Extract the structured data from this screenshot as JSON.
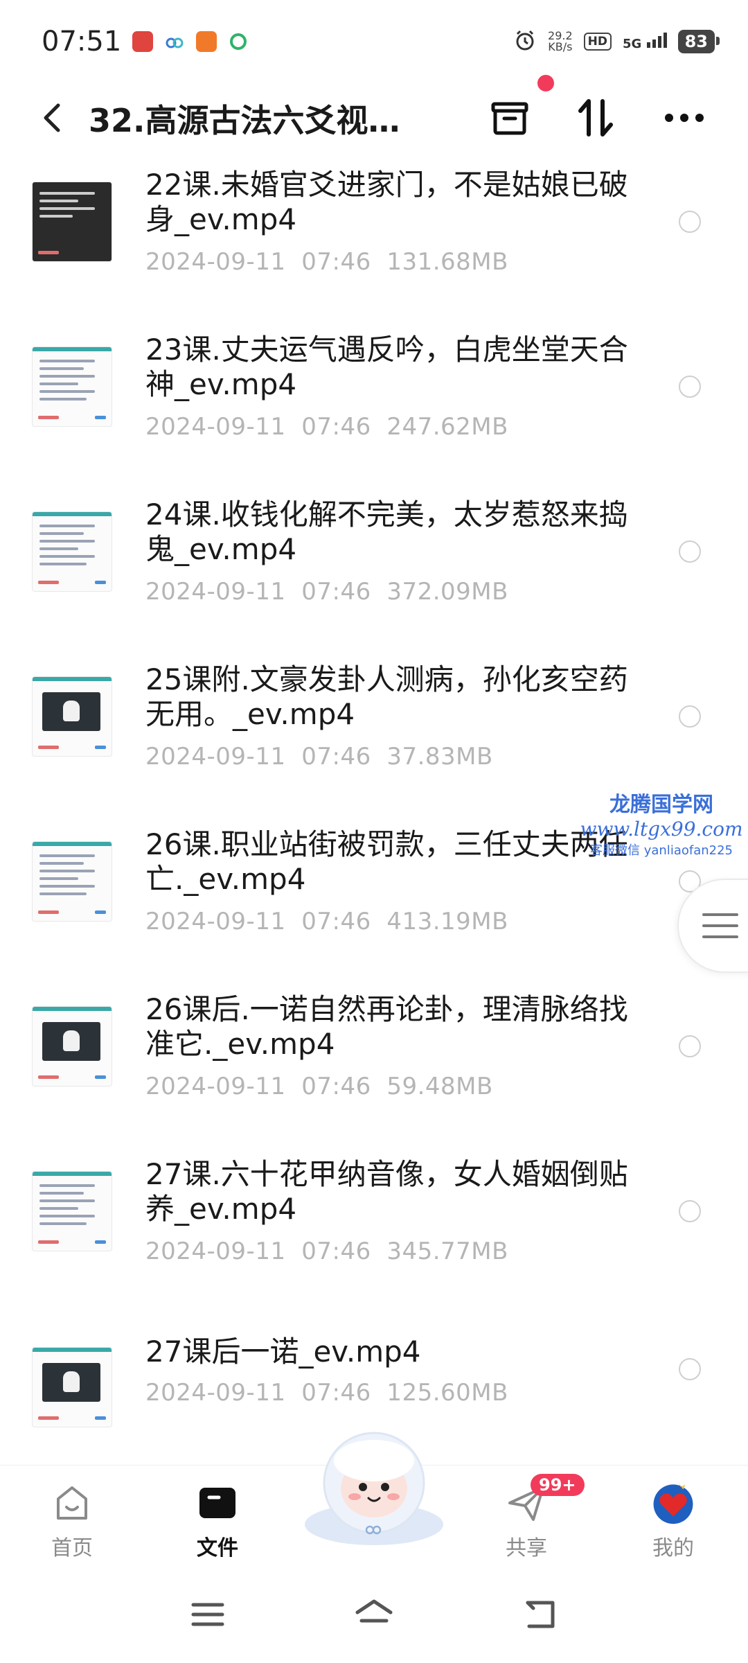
{
  "status_bar": {
    "time": "07:51",
    "speed_value": "29.2",
    "speed_unit": "KB/s",
    "hd": "HD",
    "network": "5G",
    "battery": "83"
  },
  "header": {
    "title": "32.高源古法六爻视…"
  },
  "files": [
    {
      "name": "22课.未婚官爻进家门，不是姑娘已破身_ev.mp4",
      "date": "2024-09-11",
      "time": "07:46",
      "size": "131.68MB",
      "thumb": "dark"
    },
    {
      "name": "23课.丈夫运气遇反吟，白虎坐堂天合神_ev.mp4",
      "date": "2024-09-11",
      "time": "07:46",
      "size": "247.62MB",
      "thumb": "doc"
    },
    {
      "name": "24课.收钱化解不完美，太岁惹怒来捣鬼_ev.mp4",
      "date": "2024-09-11",
      "time": "07:46",
      "size": "372.09MB",
      "thumb": "doc"
    },
    {
      "name": "25课附.文豪发卦人测病，孙化亥空药无用。_ev.mp4",
      "date": "2024-09-11",
      "time": "07:46",
      "size": "37.83MB",
      "thumb": "screen"
    },
    {
      "name": "26课.职业站街被罚款，三任丈夫两任亡._ev.mp4",
      "date": "2024-09-11",
      "time": "07:46",
      "size": "413.19MB",
      "thumb": "doc"
    },
    {
      "name": "26课后.一诺自然再论卦，理清脉络找准它._ev.mp4",
      "date": "2024-09-11",
      "time": "07:46",
      "size": "59.48MB",
      "thumb": "screen"
    },
    {
      "name": "27课.六十花甲纳音像，女人婚姻倒贴养_ev.mp4",
      "date": "2024-09-11",
      "time": "07:46",
      "size": "345.77MB",
      "thumb": "doc"
    },
    {
      "name": "27课后一诺_ev.mp4",
      "date": "2024-09-11",
      "time": "07:46",
      "size": "125.60MB",
      "thumb": "screen"
    }
  ],
  "watermark": {
    "line1": "龙腾国学网",
    "line2": "www.ltgx99.com",
    "line3": "客服微信 yanliaofan225"
  },
  "tabs": [
    {
      "label": "首页",
      "icon": "home-icon",
      "active": false
    },
    {
      "label": "文件",
      "icon": "folder-icon",
      "active": true
    },
    {
      "label": "共享",
      "icon": "paper-plane-icon",
      "active": false,
      "badge": "99+"
    },
    {
      "label": "我的",
      "icon": "avatar-heart-icon",
      "active": false
    }
  ],
  "colors": {
    "accent_red": "#f23b5a",
    "text_primary": "#1a1a1a",
    "text_meta": "#b5b5b5",
    "watermark_blue": "#3b6fd8"
  }
}
